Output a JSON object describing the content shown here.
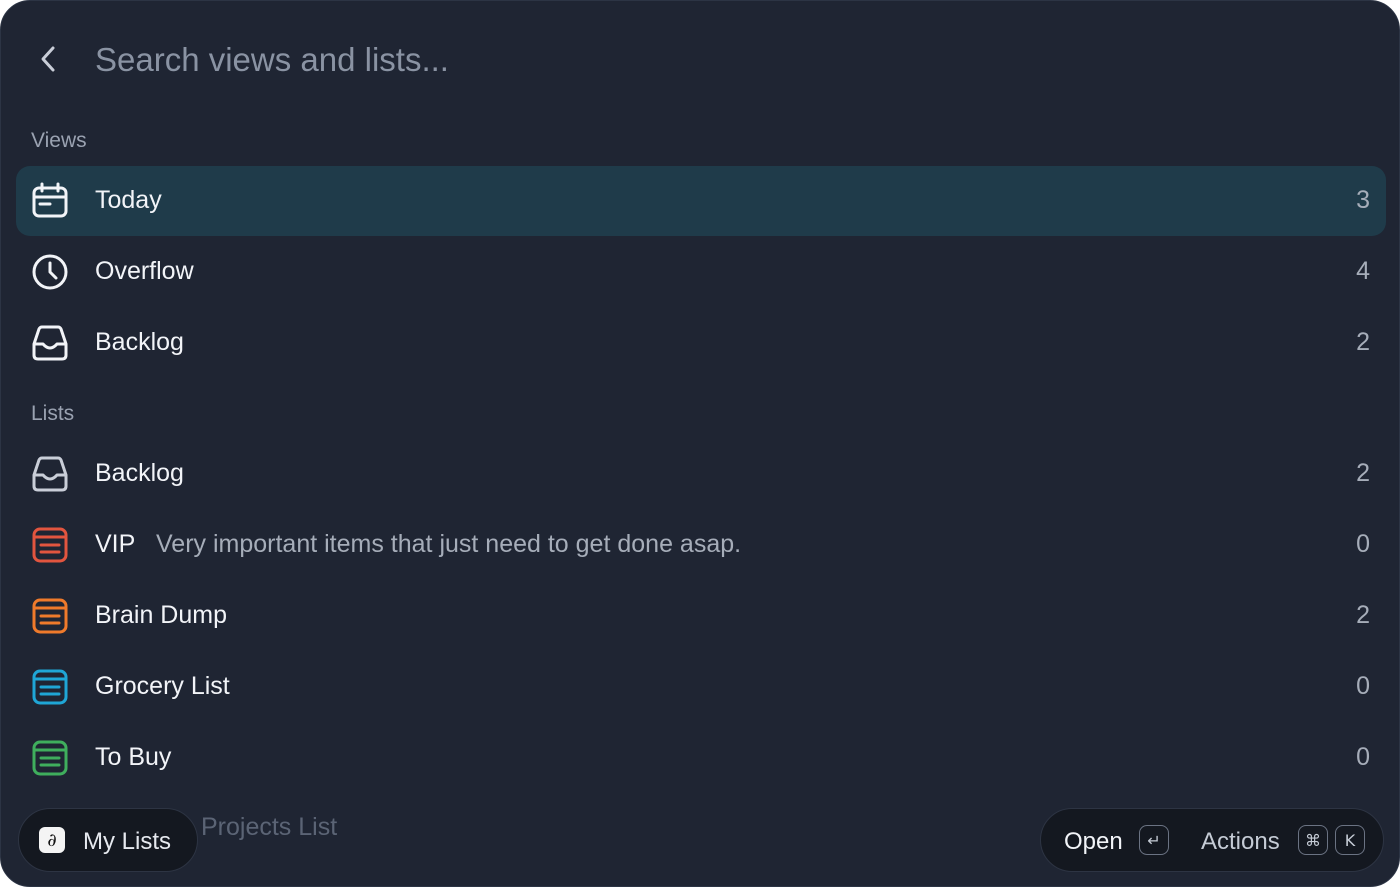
{
  "search": {
    "placeholder": "Search views and lists..."
  },
  "sections": {
    "views_title": "Views",
    "lists_title": "Lists"
  },
  "views": [
    {
      "label": "Today",
      "count": "3",
      "icon": "calendar-icon",
      "selected": true
    },
    {
      "label": "Overflow",
      "count": "4",
      "icon": "clock-icon"
    },
    {
      "label": "Backlog",
      "count": "2",
      "icon": "inbox-icon"
    }
  ],
  "lists": [
    {
      "label": "Backlog",
      "count": "2",
      "icon": "inbox-icon",
      "color": "#c9ced8"
    },
    {
      "label": "VIP",
      "description": "Very important items that just need to get done asap.",
      "count": "0",
      "icon": "list-icon",
      "color": "#e2553f"
    },
    {
      "label": "Brain Dump",
      "count": "2",
      "icon": "list-icon",
      "color": "#ef7a2b"
    },
    {
      "label": "Grocery List",
      "count": "0",
      "icon": "list-icon",
      "color": "#1fa6d6"
    },
    {
      "label": "To Buy",
      "count": "0",
      "icon": "list-icon",
      "color": "#3fae5d"
    },
    {
      "label": "Projects List",
      "count": "",
      "icon": "list-icon",
      "partially_hidden": true
    }
  ],
  "footer": {
    "my_lists_label": "My Lists",
    "app_glyph": "∂",
    "open_label": "Open",
    "open_key": "↵",
    "actions_label": "Actions",
    "actions_keys": [
      "⌘",
      "K"
    ]
  },
  "colors": {
    "background": "#1f2533",
    "selected_row": "#1f3b4a",
    "footer_pill": "#141820"
  }
}
